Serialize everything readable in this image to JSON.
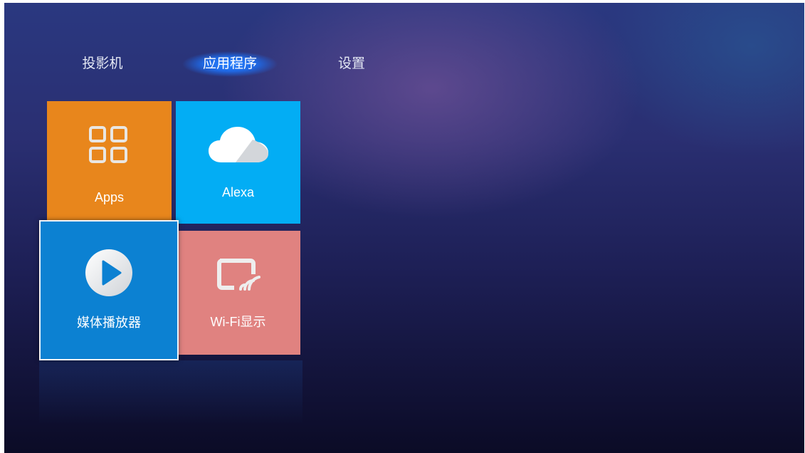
{
  "nav": {
    "tabs": [
      {
        "label": "投影机",
        "selected": false
      },
      {
        "label": "应用程序",
        "selected": true
      },
      {
        "label": "设置",
        "selected": false
      }
    ]
  },
  "tiles": {
    "apps": {
      "label": "Apps",
      "icon": "apps-grid-icon",
      "color": "#e8861c"
    },
    "alexa": {
      "label": "Alexa",
      "icon": "cloud-icon",
      "color": "#03adf4"
    },
    "media": {
      "label": "媒体播放器",
      "icon": "play-icon",
      "color": "#0c81d2",
      "focused": true
    },
    "wifi": {
      "label": "Wi-Fi显示",
      "icon": "screen-cast-icon",
      "color": "#e08280"
    }
  },
  "colors": {
    "tab_highlight": "#2c82f6",
    "background_top": "#2a3880",
    "background_bottom": "#0b0b26"
  }
}
